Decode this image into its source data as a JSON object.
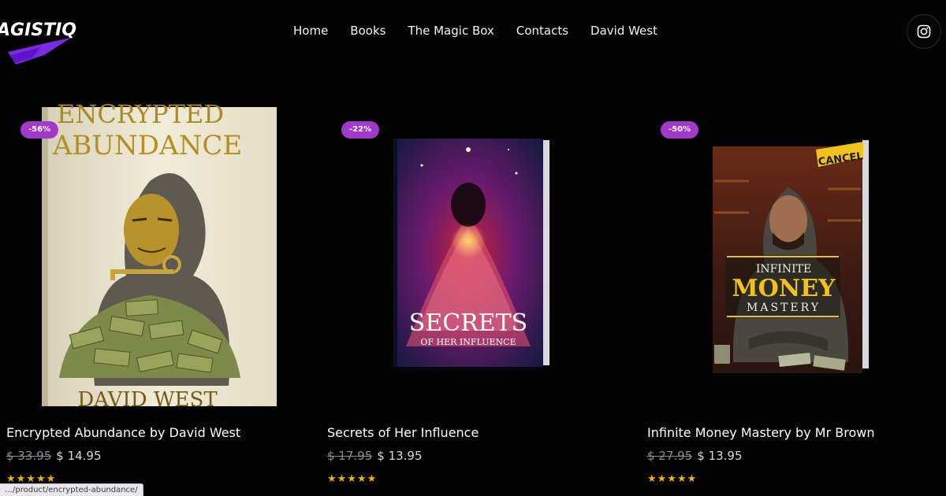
{
  "brand": {
    "logo_text": "AGISTIQ"
  },
  "nav": {
    "items": [
      "Home",
      "Books",
      "The Magic Box",
      "Contacts",
      "David West"
    ]
  },
  "social": {
    "icon": "instagram-icon"
  },
  "products": [
    {
      "badge": "-56%",
      "title": "Encrypted Abundance by David West",
      "old_price": "$ 33.95",
      "new_price": "$ 14.95",
      "stars": "★★★★★",
      "cover": {
        "title_line1": "ENCRYPTED",
        "title_line2": "ABUNDANCE",
        "author": "DAVID WEST"
      }
    },
    {
      "badge": "-22%",
      "title": "Secrets of Her Influence",
      "old_price": "$ 17.95",
      "new_price": "$ 13.95",
      "stars": "★★★★★",
      "cover": {
        "title_line1": "SECRETS",
        "title_line2": "OF HER INFLUENCE"
      }
    },
    {
      "badge": "-50%",
      "title": "Infinite Money Mastery by Mr Brown",
      "old_price": "$ 27.95",
      "new_price": "$ 13.95",
      "stars": "★★★★★",
      "cover": {
        "title_line1": "INFINITE",
        "title_line2": "MONEY",
        "title_line3": "MASTERY",
        "tag": "CANCEL"
      }
    }
  ],
  "status_bar": {
    "url": "…/product/encrypted-abundance/"
  },
  "colors": {
    "background": "#030304",
    "badge": "#a239ca",
    "stars": "#f5b301"
  }
}
